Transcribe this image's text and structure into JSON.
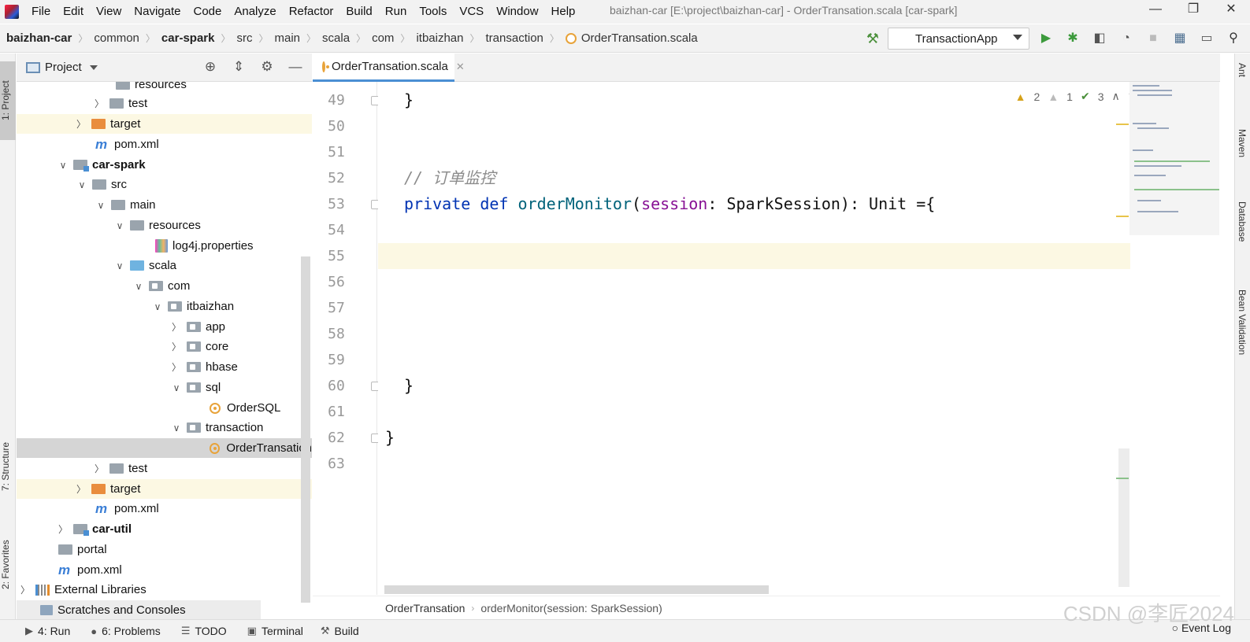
{
  "menubar": {
    "items": [
      "File",
      "Edit",
      "View",
      "Navigate",
      "Code",
      "Analyze",
      "Refactor",
      "Build",
      "Run",
      "Tools",
      "VCS",
      "Window",
      "Help"
    ],
    "window_title": "baizhan-car [E:\\project\\baizhan-car] - OrderTransation.scala [car-spark]",
    "controls": [
      "—",
      "❐",
      "✕"
    ]
  },
  "navbar": {
    "crumbs": [
      "baizhan-car",
      "common",
      "car-spark",
      "src",
      "main",
      "scala",
      "com",
      "itbaizhan",
      "transaction",
      "OrderTransation.scala"
    ],
    "run_config": "TransactionApp"
  },
  "left_strip": {
    "project": "1: Project",
    "structure": "7: Structure",
    "favorites": "2: Favorites"
  },
  "right_strip": {
    "ant": "Ant",
    "maven": "Maven",
    "database": "Database",
    "bean": "Bean Validation"
  },
  "project_panel": {
    "title": "Project"
  },
  "tree": [
    {
      "label": "resources"
    },
    {
      "label": "test"
    },
    {
      "label": "target"
    },
    {
      "label": "pom.xml"
    },
    {
      "label": "car-spark"
    },
    {
      "label": "src"
    },
    {
      "label": "main"
    },
    {
      "label": "resources"
    },
    {
      "label": "log4j.properties"
    },
    {
      "label": "scala"
    },
    {
      "label": "com"
    },
    {
      "label": "itbaizhan"
    },
    {
      "label": "app"
    },
    {
      "label": "core"
    },
    {
      "label": "hbase"
    },
    {
      "label": "sql"
    },
    {
      "label": "OrderSQL"
    },
    {
      "label": "transaction"
    },
    {
      "label": "OrderTransation"
    },
    {
      "label": "test"
    },
    {
      "label": "target"
    },
    {
      "label": "pom.xml"
    },
    {
      "label": "car-util"
    },
    {
      "label": "portal"
    },
    {
      "label": "pom.xml"
    },
    {
      "label": "External Libraries"
    },
    {
      "label": "Scratches and Consoles"
    }
  ],
  "editor": {
    "tab": "OrderTransation.scala",
    "line_numbers": [
      "49",
      "50",
      "51",
      "52",
      "53",
      "54",
      "55",
      "56",
      "57",
      "58",
      "59",
      "60",
      "61",
      "62",
      "63"
    ],
    "code": {
      "l49": "}",
      "l52": "// 订单监控",
      "l53_kw1": "private",
      "l53_kw2": "def",
      "l53_fn": "orderMonitor",
      "l53_open": "(",
      "l53_param": "session",
      "l53_rest": ": SparkSession): Unit ={",
      "l60": "}",
      "l62": "}"
    },
    "inspections": {
      "warn_major": "2",
      "warn_minor": "1",
      "ok": "3"
    },
    "breadcrumb": [
      "OrderTransation",
      "orderMonitor(session: SparkSession)"
    ]
  },
  "bottombar": {
    "run": "4: Run",
    "problems": "6: Problems",
    "todo": "TODO",
    "terminal": "Terminal",
    "build": "Build",
    "event_log": "Event Log"
  },
  "watermark": "CSDN @李匠2024"
}
